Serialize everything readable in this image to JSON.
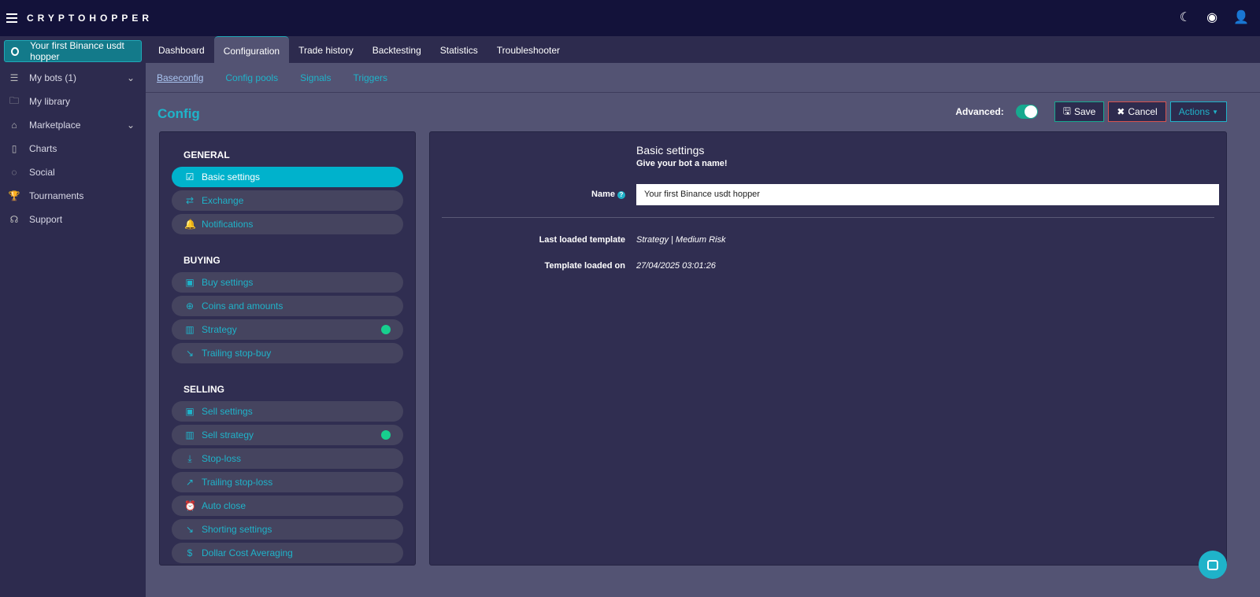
{
  "header": {
    "logo": "CRYPTOHOPPER"
  },
  "sidebar": {
    "bot": "Your first Binance usdt hopper",
    "items": [
      {
        "label": "My bots (1)",
        "icon": "database-icon",
        "chev": true
      },
      {
        "label": "My library",
        "icon": "folder-icon"
      },
      {
        "label": "Marketplace",
        "icon": "store-icon",
        "chev": true
      },
      {
        "label": "Charts",
        "icon": "bar-chart-icon"
      },
      {
        "label": "Social",
        "icon": "social-icon"
      },
      {
        "label": "Tournaments",
        "icon": "trophy-icon"
      },
      {
        "label": "Support",
        "icon": "headset-icon"
      }
    ]
  },
  "tabs": [
    "Dashboard",
    "Configuration",
    "Trade history",
    "Backtesting",
    "Statistics",
    "Troubleshooter"
  ],
  "subtabs": [
    "Baseconfig",
    "Config pools",
    "Signals",
    "Triggers"
  ],
  "config": {
    "title": "Config",
    "advanced": "Advanced:",
    "save": "Save",
    "cancel": "Cancel",
    "actions": "Actions"
  },
  "menu": {
    "general": "GENERAL",
    "buying": "BUYING",
    "selling": "SELLING",
    "general_items": [
      {
        "label": "Basic settings",
        "icon": "☑"
      },
      {
        "label": "Exchange",
        "icon": "⇄"
      },
      {
        "label": "Notifications",
        "icon": "🔔"
      }
    ],
    "buying_items": [
      {
        "label": "Buy settings",
        "icon": "▣"
      },
      {
        "label": "Coins and amounts",
        "icon": "⊕"
      },
      {
        "label": "Strategy",
        "icon": "▥",
        "dot": true
      },
      {
        "label": "Trailing stop-buy",
        "icon": "↘"
      }
    ],
    "selling_items": [
      {
        "label": "Sell settings",
        "icon": "▣"
      },
      {
        "label": "Sell strategy",
        "icon": "▥",
        "dot": true
      },
      {
        "label": "Stop-loss",
        "icon": "⤓"
      },
      {
        "label": "Trailing stop-loss",
        "icon": "↗"
      },
      {
        "label": "Auto close",
        "icon": "⏰"
      },
      {
        "label": "Shorting settings",
        "icon": "↘"
      },
      {
        "label": "Dollar Cost Averaging",
        "icon": "$"
      }
    ]
  },
  "basic": {
    "title": "Basic settings",
    "subtitle": "Give your bot a name!",
    "name_label": "Name",
    "name_value": "Your first Binance usdt hopper",
    "template_label": "Last loaded template",
    "template_value": "Strategy | Medium Risk",
    "loaded_label": "Template loaded on",
    "loaded_value": "27/04/2025 03:01:26"
  }
}
